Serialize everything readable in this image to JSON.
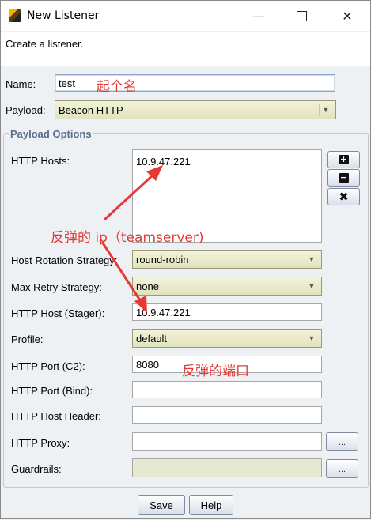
{
  "window": {
    "title": "New Listener",
    "minimize": "—",
    "close": "✕"
  },
  "description": "Create a listener.",
  "name": {
    "label": "Name:",
    "value": "test"
  },
  "payload": {
    "label": "Payload:",
    "value": "Beacon HTTP"
  },
  "payload_options": {
    "legend": "Payload Options",
    "http_hosts": {
      "label": "HTTP Hosts:",
      "items": [
        "10.9.47.221"
      ]
    },
    "host_rotation": {
      "label": "Host Rotation Strategy:",
      "value": "round-robin"
    },
    "max_retry": {
      "label": "Max Retry Strategy:",
      "value": "none"
    },
    "host_stager": {
      "label": "HTTP Host (Stager):",
      "value": "10.9.47.221"
    },
    "profile": {
      "label": "Profile:",
      "value": "default"
    },
    "port_c2": {
      "label": "HTTP Port (C2):",
      "value": "8080"
    },
    "port_bind": {
      "label": "HTTP Port (Bind):",
      "value": ""
    },
    "host_header": {
      "label": "HTTP Host Header:",
      "value": ""
    },
    "proxy": {
      "label": "HTTP Proxy:",
      "value": "",
      "button": "..."
    },
    "guardrails": {
      "label": "Guardrails:",
      "value": "",
      "button": "..."
    }
  },
  "buttons": {
    "save": "Save",
    "help": "Help"
  },
  "annotations": {
    "name_note": "起个名",
    "ip_note": "反弹的 ip（teamserver)",
    "port_note": "反弹的端口",
    "color": "#e53935"
  },
  "icons": {
    "add": "plus-icon",
    "remove": "minus-icon",
    "clear": "x-icon",
    "dropdown": "chevron-down-icon"
  }
}
